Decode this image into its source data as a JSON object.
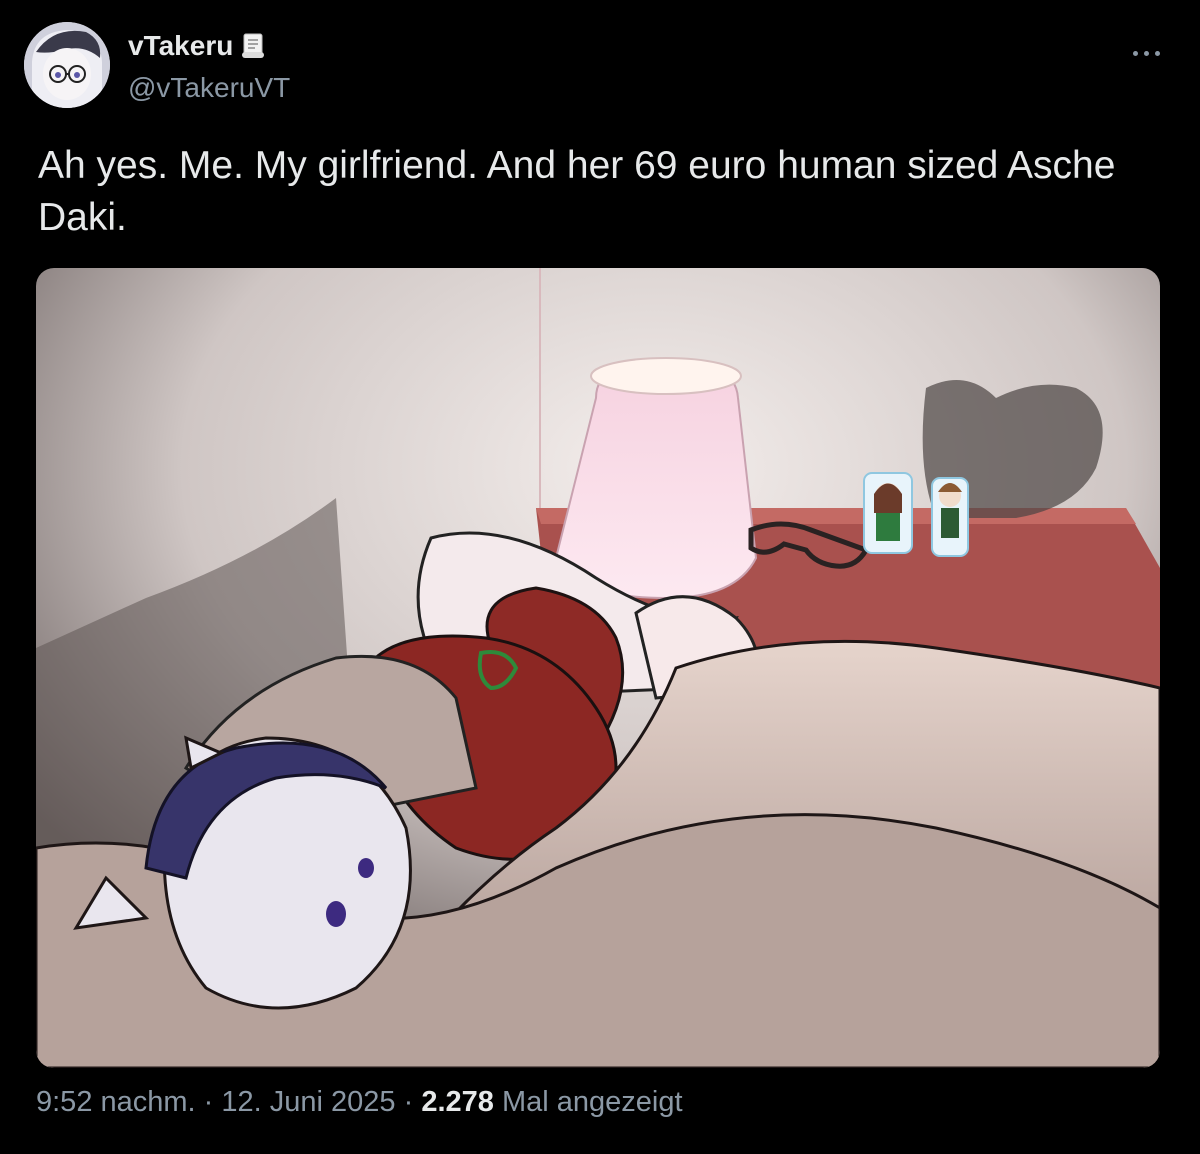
{
  "author": {
    "display_name": "vTakeru",
    "badge_icon": "scroll-emoji-icon",
    "handle": "@vTakeruVT",
    "avatar_icon": "avatar-icon"
  },
  "more_icon": "more-horizontal-icon",
  "tweet": {
    "text": "Ah yes. Me. My girlfriend. And her 69 euro human sized Asche Daki."
  },
  "meta": {
    "time": "9:52 nachm.",
    "sep1": "·",
    "date": "12. Juni 2025",
    "sep2": "·",
    "views_count": "2.278",
    "views_label": "Mal angezeigt"
  },
  "colors": {
    "background": "#000000",
    "text_primary": "#e7e9ea",
    "text_secondary": "#8b98a5"
  }
}
